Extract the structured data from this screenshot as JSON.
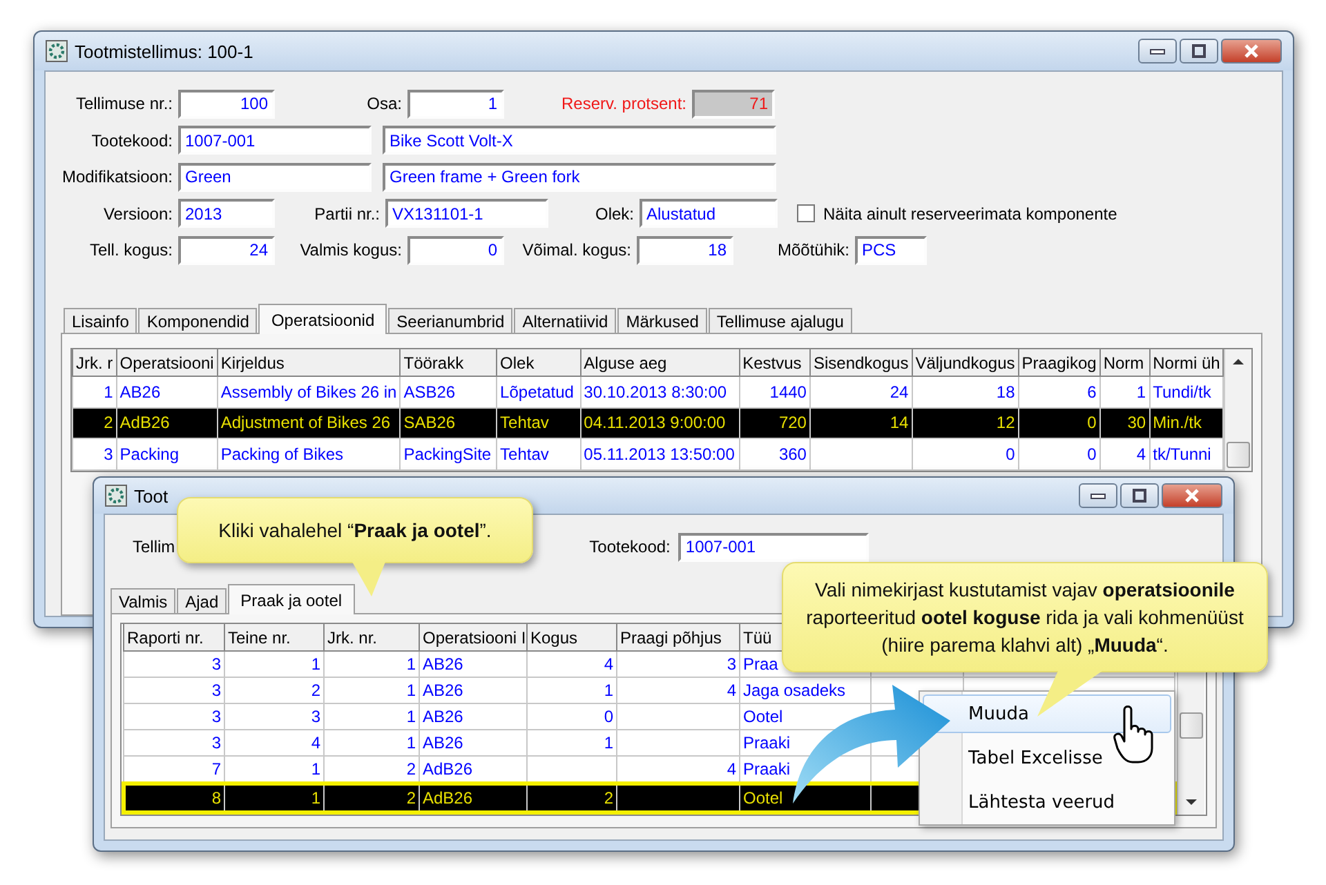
{
  "main_window": {
    "title": "Tootmistellimus: 100-1",
    "form": {
      "order_no": {
        "label": "Tellimuse nr.:",
        "value": "100"
      },
      "part": {
        "label": "Osa:",
        "value": "1"
      },
      "reserve_percent": {
        "label": "Reserv. protsent:",
        "value": "71",
        "disabled": true
      },
      "product_code": {
        "label": "Tootekood:",
        "value": "1007-001"
      },
      "product_name": {
        "value": "Bike Scott Volt-X"
      },
      "modification": {
        "label": "Modifikatsioon:",
        "value": "Green"
      },
      "modification_name": {
        "value": "Green frame + Green fork"
      },
      "version": {
        "label": "Versioon:",
        "value": "2013"
      },
      "batch_no": {
        "label": "Partii nr.:",
        "value": "VX131101-1"
      },
      "status": {
        "label": "Olek:",
        "value": "Alustatud"
      },
      "show_unreserved": {
        "label": "Näita ainult reserveerimata komponente",
        "checked": false
      },
      "ordered_qty": {
        "label": "Tell. kogus:",
        "value": "24"
      },
      "finished_qty": {
        "label": "Valmis kogus:",
        "value": "0"
      },
      "possible_qty": {
        "label": "Võimal. kogus:",
        "value": "18"
      },
      "unit": {
        "label": "Mõõtühik:",
        "value": "PCS"
      }
    },
    "tabs": [
      {
        "label": "Lisainfo",
        "selected": false
      },
      {
        "label": "Komponendid",
        "selected": false
      },
      {
        "label": "Operatsioonid",
        "selected": true
      },
      {
        "label": "Seerianumbrid",
        "selected": false
      },
      {
        "label": "Alternatiivid",
        "selected": false
      },
      {
        "label": "Märkused",
        "selected": false
      },
      {
        "label": "Tellimuse ajalugu",
        "selected": false
      }
    ],
    "table": {
      "columns": [
        "Jrk. r",
        "Operatsiooni",
        "Kirjeldus",
        "Töörakk",
        "Olek",
        "Alguse aeg",
        "Kestvus",
        "Sisendkogus",
        "Väljundkogus",
        "Praagikog",
        "Norm",
        "Normi üh"
      ],
      "rows": [
        {
          "cells": [
            "1",
            "AB26",
            "Assembly of Bikes 26 in",
            "ASB26",
            "Lõpetatud",
            "30.10.2013 8:30:00",
            "1440",
            "24",
            "18",
            "6",
            "1",
            "Tundi/tk"
          ],
          "selected": false
        },
        {
          "cells": [
            "2",
            "AdB26",
            "Adjustment of Bikes 26",
            "SAB26",
            "Tehtav",
            "04.11.2013 9:00:00",
            "720",
            "14",
            "12",
            "0",
            "30",
            "Min./tk"
          ],
          "selected": true
        },
        {
          "cells": [
            "3",
            "Packing",
            "Packing of Bikes",
            "PackingSite",
            "Tehtav",
            "05.11.2013 13:50:00",
            "360",
            "",
            "0",
            "0",
            "4",
            "tk/Tunni"
          ],
          "selected": false
        }
      ]
    }
  },
  "report_window": {
    "title": "Toot",
    "order_label": "Tellim",
    "product_code": {
      "label": "Tootekood:",
      "value": "1007-001"
    },
    "tabs": [
      {
        "label": "Valmis",
        "selected": false
      },
      {
        "label": "Ajad",
        "selected": false
      },
      {
        "label": "Praak ja ootel",
        "selected": true
      }
    ],
    "table": {
      "columns": [
        "Raporti nr.",
        "Teine nr.",
        "Jrk. nr.",
        "Operatsiooni I",
        "Kogus",
        "Praagi põhjus",
        "Tüü"
      ],
      "rows": [
        {
          "cells": [
            "3",
            "1",
            "1",
            "AB26",
            "4",
            "3",
            "Praa"
          ],
          "selected": false
        },
        {
          "cells": [
            "3",
            "2",
            "1",
            "AB26",
            "1",
            "4",
            "Jaga osadeks"
          ],
          "selected": false
        },
        {
          "cells": [
            "3",
            "3",
            "1",
            "AB26",
            "0",
            "",
            "Ootel"
          ],
          "selected": false
        },
        {
          "cells": [
            "3",
            "4",
            "1",
            "AB26",
            "1",
            "",
            "Praaki"
          ],
          "selected": false
        },
        {
          "cells": [
            "7",
            "1",
            "2",
            "AdB26",
            "",
            "4",
            "Praaki"
          ],
          "selected": false
        },
        {
          "cells": [
            "8",
            "1",
            "2",
            "AdB26",
            "2",
            "",
            "Ootel"
          ],
          "selected": true
        }
      ]
    }
  },
  "context_menu": [
    {
      "label": "Muuda",
      "selected": true
    },
    {
      "label": "Tabel Excelisse",
      "selected": false
    },
    {
      "label": "Lähtesta veerud",
      "selected": false
    }
  ],
  "callouts": [
    {
      "text": "Kliki vahalehel “**Praak ja ootel**”."
    },
    {
      "text": "Vali nimekirjast kustutamist vajav **operatsioonile** raporteeritud **ootel koguse** rida ja vali kohmenüüst (hiire parema klahvi alt) „**Muuda**“."
    }
  ]
}
